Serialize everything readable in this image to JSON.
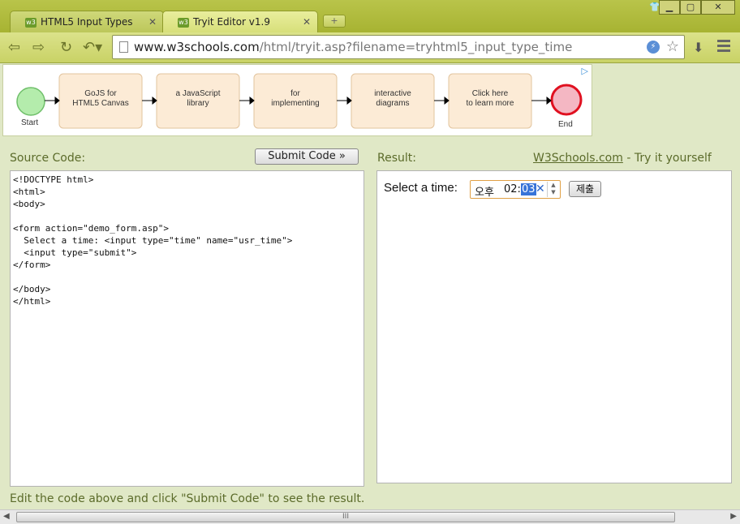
{
  "tabs": [
    {
      "label": "HTML5 Input Types",
      "active": false,
      "favicon": "w3"
    },
    {
      "label": "Tryit Editor v1.9",
      "active": true,
      "favicon": "w3"
    }
  ],
  "window_controls": {
    "minimize": "▁",
    "maximize": "▢",
    "close": "✕"
  },
  "address_bar": {
    "host": "www.w3schools.com",
    "path": "/html/tryit.asp?filename=tryhtml5_input_type_time"
  },
  "ad": {
    "choices_label": "▷",
    "start_label": "Start",
    "end_label": "End",
    "steps": [
      {
        "line1": "GoJS for",
        "line2": "HTML5 Canvas"
      },
      {
        "line1": "a JavaScript",
        "line2": "library"
      },
      {
        "line1": "for",
        "line2": "implementing"
      },
      {
        "line1": "interactive",
        "line2": "diagrams"
      },
      {
        "line1": "Click here",
        "line2": "to learn more"
      }
    ]
  },
  "editor": {
    "source_title": "Source Code:",
    "submit_label": "Submit Code »",
    "code": "<!DOCTYPE html>\n<html>\n<body>\n\n<form action=\"demo_form.asp\">\n  Select a time: <input type=\"time\" name=\"usr_time\">\n  <input type=\"submit\">\n</form>\n\n</body>\n</html>",
    "result_title": "Result:",
    "w3_link": "W3Schools.com",
    "w3_suffix": " - Try it yourself",
    "footer": "Edit the code above and click \"Submit Code\" to see the result."
  },
  "result": {
    "label": "Select a time:",
    "ampm": "오후",
    "hour": "02",
    "minute": "03",
    "submit_label": "제출"
  },
  "scrollbar": {
    "grip": "III"
  }
}
